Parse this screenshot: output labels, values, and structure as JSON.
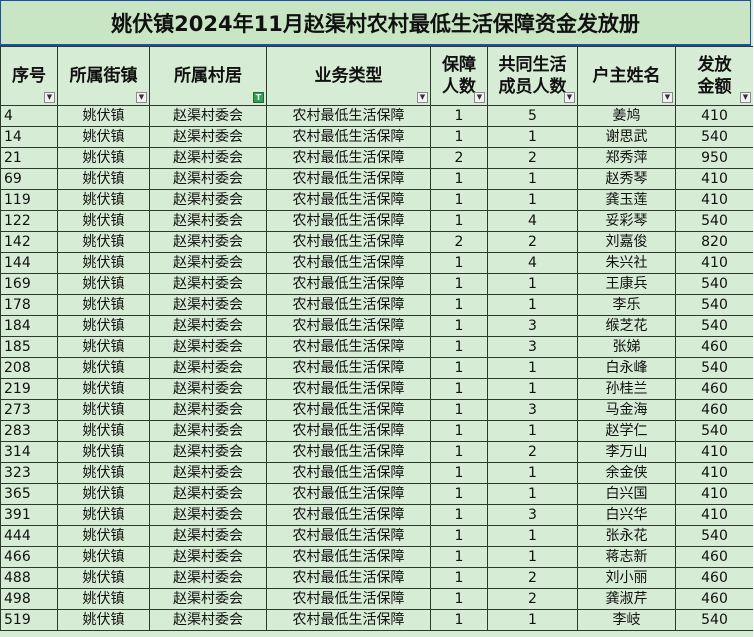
{
  "title": "姚伏镇2024年11月赵渠村农村最低生活保障资金发放册",
  "headers": [
    "序号",
    "所属街镇",
    "所属村居",
    "业务类型",
    "保障人数",
    "共同生活成员人数",
    "户主姓名",
    "发放金额"
  ],
  "header_lines": [
    [
      "序号"
    ],
    [
      "所属街镇"
    ],
    [
      "所属村居"
    ],
    [
      "业务类型"
    ],
    [
      "保障",
      "人数"
    ],
    [
      "共同生活",
      "成员人数"
    ],
    [
      "户主姓名"
    ],
    [
      "发放",
      "金额"
    ]
  ],
  "filter_icon": "chevron-down-icon",
  "filter_active_icon": "filter-active-icon",
  "colors": {
    "cell_bg": "#d6ecd4",
    "border": "#2f3a2f",
    "title_border": "#1f4fa0",
    "filter_active": "#2e9f4e"
  },
  "rows": [
    [
      "4",
      "姚伏镇",
      "赵渠村委会",
      "农村最低生活保障",
      "1",
      "5",
      "姜鸠",
      "410"
    ],
    [
      "14",
      "姚伏镇",
      "赵渠村委会",
      "农村最低生活保障",
      "1",
      "1",
      "谢思武",
      "540"
    ],
    [
      "21",
      "姚伏镇",
      "赵渠村委会",
      "农村最低生活保障",
      "2",
      "2",
      "郑秀萍",
      "950"
    ],
    [
      "69",
      "姚伏镇",
      "赵渠村委会",
      "农村最低生活保障",
      "1",
      "1",
      "赵秀琴",
      "410"
    ],
    [
      "119",
      "姚伏镇",
      "赵渠村委会",
      "农村最低生活保障",
      "1",
      "1",
      "龚玉莲",
      "410"
    ],
    [
      "122",
      "姚伏镇",
      "赵渠村委会",
      "农村最低生活保障",
      "1",
      "4",
      "妥彩琴",
      "540"
    ],
    [
      "142",
      "姚伏镇",
      "赵渠村委会",
      "农村最低生活保障",
      "2",
      "2",
      "刘嘉俊",
      "820"
    ],
    [
      "144",
      "姚伏镇",
      "赵渠村委会",
      "农村最低生活保障",
      "1",
      "4",
      "朱兴社",
      "410"
    ],
    [
      "169",
      "姚伏镇",
      "赵渠村委会",
      "农村最低生活保障",
      "1",
      "1",
      "王康兵",
      "540"
    ],
    [
      "178",
      "姚伏镇",
      "赵渠村委会",
      "农村最低生活保障",
      "1",
      "1",
      "李乐",
      "540"
    ],
    [
      "184",
      "姚伏镇",
      "赵渠村委会",
      "农村最低生活保障",
      "1",
      "3",
      "缑芝花",
      "540"
    ],
    [
      "185",
      "姚伏镇",
      "赵渠村委会",
      "农村最低生活保障",
      "1",
      "3",
      "张娣",
      "460"
    ],
    [
      "208",
      "姚伏镇",
      "赵渠村委会",
      "农村最低生活保障",
      "1",
      "1",
      "白永峰",
      "540"
    ],
    [
      "219",
      "姚伏镇",
      "赵渠村委会",
      "农村最低生活保障",
      "1",
      "1",
      "孙桂兰",
      "460"
    ],
    [
      "273",
      "姚伏镇",
      "赵渠村委会",
      "农村最低生活保障",
      "1",
      "3",
      "马金海",
      "460"
    ],
    [
      "283",
      "姚伏镇",
      "赵渠村委会",
      "农村最低生活保障",
      "1",
      "1",
      "赵学仁",
      "540"
    ],
    [
      "314",
      "姚伏镇",
      "赵渠村委会",
      "农村最低生活保障",
      "1",
      "2",
      "李万山",
      "410"
    ],
    [
      "323",
      "姚伏镇",
      "赵渠村委会",
      "农村最低生活保障",
      "1",
      "1",
      "余金侠",
      "410"
    ],
    [
      "365",
      "姚伏镇",
      "赵渠村委会",
      "农村最低生活保障",
      "1",
      "1",
      "白兴国",
      "410"
    ],
    [
      "391",
      "姚伏镇",
      "赵渠村委会",
      "农村最低生活保障",
      "1",
      "3",
      "白兴华",
      "410"
    ],
    [
      "444",
      "姚伏镇",
      "赵渠村委会",
      "农村最低生活保障",
      "1",
      "1",
      "张永花",
      "540"
    ],
    [
      "466",
      "姚伏镇",
      "赵渠村委会",
      "农村最低生活保障",
      "1",
      "1",
      "蒋志新",
      "460"
    ],
    [
      "488",
      "姚伏镇",
      "赵渠村委会",
      "农村最低生活保障",
      "1",
      "2",
      "刘小丽",
      "460"
    ],
    [
      "498",
      "姚伏镇",
      "赵渠村委会",
      "农村最低生活保障",
      "1",
      "2",
      "龚淑芹",
      "460"
    ],
    [
      "519",
      "姚伏镇",
      "赵渠村委会",
      "农村最低生活保障",
      "1",
      "1",
      "李岐",
      "540"
    ]
  ]
}
